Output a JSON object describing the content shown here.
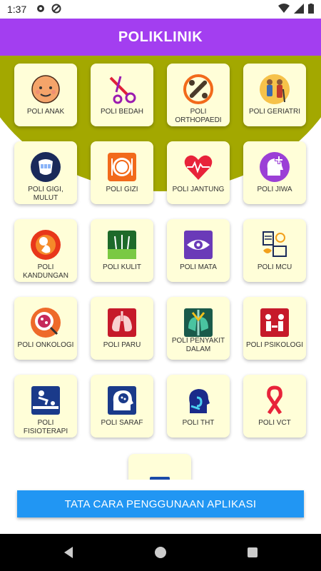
{
  "status": {
    "time": "1:37"
  },
  "app": {
    "title": "POLIKLINIK"
  },
  "tiles": [
    {
      "label": "POLI ANAK",
      "icon": "baby-face-icon"
    },
    {
      "label": "POLI BEDAH",
      "icon": "surgery-scissors-icon"
    },
    {
      "label": "POLI ORTHOPAEDI",
      "icon": "bone-joint-icon"
    },
    {
      "label": "POLI GERIATRI",
      "icon": "elderly-couple-icon"
    },
    {
      "label": "POLI GIGI, MULUT",
      "icon": "dental-mouth-icon"
    },
    {
      "label": "POLI GIZI",
      "icon": "nutrition-plate-icon"
    },
    {
      "label": "POLI JANTUNG",
      "icon": "heart-pulse-icon"
    },
    {
      "label": "POLI JIWA",
      "icon": "mental-health-head-icon"
    },
    {
      "label": "POLI KANDUNGAN",
      "icon": "fetus-icon"
    },
    {
      "label": "POLI KULIT",
      "icon": "skin-hair-icon"
    },
    {
      "label": "POLI MATA",
      "icon": "eye-icon"
    },
    {
      "label": "POLI MCU",
      "icon": "medical-checkup-icon"
    },
    {
      "label": "POLI ONKOLOGI",
      "icon": "cancer-cell-icon"
    },
    {
      "label": "POLI PARU",
      "icon": "lungs-icon"
    },
    {
      "label": "POLI PENYAKIT DALAM",
      "icon": "internal-organs-icon"
    },
    {
      "label": "POLI PSIKOLOGI",
      "icon": "counseling-icon"
    },
    {
      "label": "POLI FISIOTERAPI",
      "icon": "physiotherapy-icon"
    },
    {
      "label": "POLI SARAF",
      "icon": "brain-nerve-icon"
    },
    {
      "label": "POLI THT",
      "icon": "ear-nose-throat-icon"
    },
    {
      "label": "POLI VCT",
      "icon": "awareness-ribbon-icon"
    }
  ],
  "bottom_button": {
    "label": "TATA CARA PENGGUNAAN APLIKASI"
  },
  "colors": {
    "app_bar": "#a33ef0",
    "olive": "#a3a800",
    "tile": "#fffed8",
    "button": "#2196f3"
  }
}
